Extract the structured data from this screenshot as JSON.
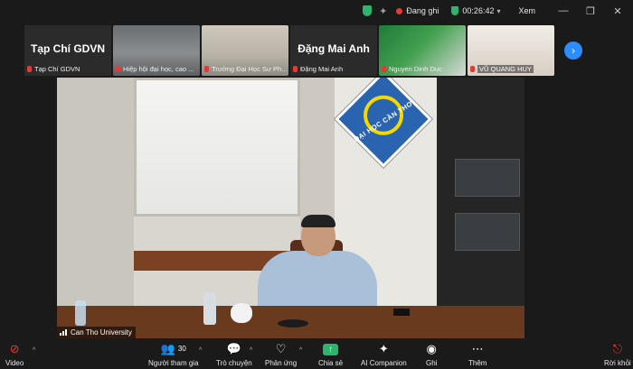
{
  "topbar": {
    "recording_label": "Đang ghi",
    "timer": "00:26:42",
    "view_label": "Xem",
    "icons": [
      "security-shield-icon",
      "sparkle-icon",
      "recording-dot-icon",
      "timer-shield-icon",
      "chevron-down-icon",
      "minimize-icon",
      "restore-icon",
      "close-icon"
    ]
  },
  "participants": [
    {
      "big_name": "Tạp Chí GDVN",
      "caption": "Tạp Chí GDVN",
      "has_video": false
    },
    {
      "big_name": "",
      "caption": "Hiệp hội đại học, cao ...",
      "has_video": true
    },
    {
      "big_name": "",
      "caption": "Trường Đại Học Sư Ph...",
      "has_video": true
    },
    {
      "big_name": "Đặng Mai Anh",
      "caption": "Đặng Mai Anh",
      "has_video": false
    },
    {
      "big_name": "",
      "caption": "Nguyen Dinh Duc",
      "has_video": true
    },
    {
      "big_name": "",
      "caption": "VŨ QUANG HUY",
      "has_video": true
    }
  ],
  "strip_next_icon": "chevron-right-icon",
  "main_video": {
    "speaker_label": "Can Tho University",
    "logo_text": "ĐẠI HỌC CẦN THƠ"
  },
  "toolbar": {
    "video_label": "Video",
    "participants_label": "Người tham gia",
    "participants_count": "30",
    "chat_label": "Trò chuyện",
    "reactions_label": "Phản ứng",
    "share_label": "Chia sẻ",
    "companion_label": "AI Companion",
    "record_label": "Ghi",
    "more_label": "Thêm",
    "leave_label": "Rời khỏi"
  },
  "colors": {
    "accent_blue": "#2d8cff",
    "share_green": "#2fb36d",
    "alert_red": "#e53935"
  }
}
